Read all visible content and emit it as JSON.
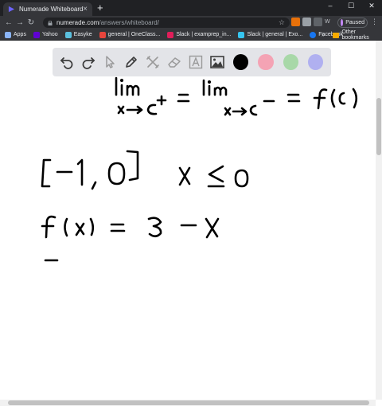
{
  "browser": {
    "tab_title": "Numerade Whiteboard",
    "tab_close": "×",
    "new_tab": "+",
    "window_controls": {
      "minimize": "–",
      "maximize": "☐",
      "close": "✕"
    },
    "nav": {
      "back": "←",
      "forward": "→",
      "reload": "↻"
    },
    "url_host": "numerade.com",
    "url_path": "/answers/whiteboard/",
    "star": "☆",
    "ext_label": "W",
    "profile_label": "Paused",
    "menu": "⋮"
  },
  "bookmarks": {
    "items": [
      {
        "label": "Apps",
        "icon": "apps-icon",
        "color": "#8ab4f8"
      },
      {
        "label": "Yahoo",
        "icon": "yahoo-icon",
        "color": "#6001d2"
      },
      {
        "label": "Easyke",
        "icon": "easyke-icon",
        "color": "#5bc0de"
      },
      {
        "label": "general | OneClass...",
        "icon": "oneclass-icon",
        "color": "#e8453c"
      },
      {
        "label": "Slack | examprep_in...",
        "icon": "slack-icon",
        "color": "#e01e5a"
      },
      {
        "label": "Slack | general | Exo...",
        "icon": "slack-icon",
        "color": "#36c5f0"
      },
      {
        "label": "Facebook",
        "icon": "facebook-icon",
        "color": "#1877f2"
      }
    ],
    "more": "»",
    "other_label": "Other bookmarks"
  },
  "whiteboard": {
    "tools": [
      "undo-icon",
      "redo-icon",
      "select-icon",
      "pen-icon",
      "tools-icon",
      "eraser-icon",
      "text-icon",
      "image-icon"
    ],
    "colors": [
      "#000000",
      "#f4a3b4",
      "#a8d8a8",
      "#b0b0f0"
    ]
  }
}
